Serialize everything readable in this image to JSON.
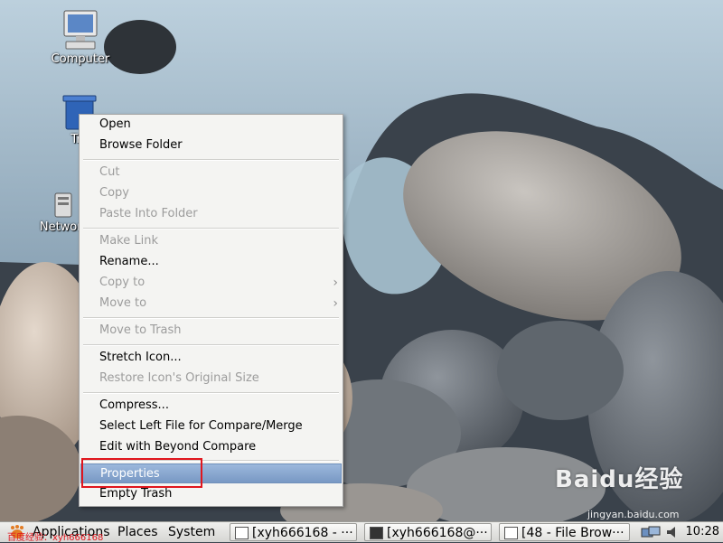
{
  "desktop": {
    "icons": [
      {
        "label": "Computer",
        "icon": "computer-icon"
      },
      {
        "label": "Tra",
        "icon": "trash-icon"
      },
      {
        "label": "Network",
        "icon": "network-icon"
      }
    ]
  },
  "context_menu": {
    "items": [
      {
        "label": "Open",
        "enabled": true
      },
      {
        "label": "Browse Folder",
        "enabled": true
      },
      {
        "label": "Cut",
        "enabled": false
      },
      {
        "label": "Copy",
        "enabled": false
      },
      {
        "label": "Paste Into Folder",
        "enabled": false
      },
      {
        "label": "Make Link",
        "enabled": false
      },
      {
        "label": "Rename...",
        "enabled": true
      },
      {
        "label": "Copy to",
        "enabled": false,
        "submenu": true
      },
      {
        "label": "Move to",
        "enabled": false,
        "submenu": true
      },
      {
        "label": "Move to Trash",
        "enabled": false
      },
      {
        "label": "Stretch Icon...",
        "enabled": true
      },
      {
        "label": "Restore Icon's Original Size",
        "enabled": false
      },
      {
        "label": "Compress...",
        "enabled": true
      },
      {
        "label": "Select Left File for Compare/Merge",
        "enabled": true
      },
      {
        "label": "Edit with Beyond Compare",
        "enabled": true
      },
      {
        "label": "Properties",
        "enabled": true,
        "highlighted": true
      },
      {
        "label": "Empty Trash",
        "enabled": true
      }
    ],
    "highlight_color": "#7898c4",
    "annotation_color": "#e0161e"
  },
  "panel": {
    "menus": [
      "Applications",
      "Places",
      "System"
    ],
    "tasks": [
      {
        "label": "[xyh666168 - ···",
        "icon": "window-icon"
      },
      {
        "label": "[xyh666168@···",
        "icon": "terminal-icon"
      },
      {
        "label": "[48 - File Brow···",
        "icon": "file-browser-icon"
      }
    ],
    "clock": "10:28"
  },
  "watermark": {
    "brand": "Baidu经验",
    "url": "jingyan.baidu.com",
    "author": "百度经验：xyh666168"
  }
}
